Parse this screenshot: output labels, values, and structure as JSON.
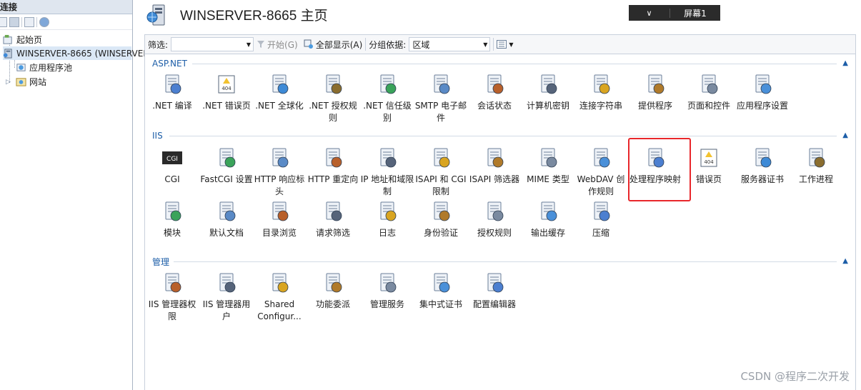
{
  "connections": {
    "header": "连接",
    "tree": [
      {
        "label": "起始页"
      },
      {
        "label": "WINSERVER-8665 (WINSERVER"
      },
      {
        "label": "应用程序池"
      },
      {
        "label": "网站"
      }
    ]
  },
  "header": {
    "title": "WINSERVER-8665 主页"
  },
  "overlay": {
    "chevron": "∨",
    "label": "屏幕1"
  },
  "filterbar": {
    "filter_label": "筛选:",
    "filter_value": "",
    "go_label": "开始(G)",
    "showall_label": "全部显示(A)",
    "groupby_label": "分组依据:",
    "groupby_value": "区域"
  },
  "groups": [
    {
      "title": "ASP.NET",
      "items": [
        {
          "label": ".NET 编译",
          "icon": "dotnet-compile-icon"
        },
        {
          "label": ".NET 错误页",
          "icon": "error-404-icon"
        },
        {
          "label": ".NET 全球化",
          "icon": "globe-icon"
        },
        {
          "label": ".NET 授权规则",
          "icon": "lock-doc-icon"
        },
        {
          "label": ".NET 信任级别",
          "icon": "trust-check-icon"
        },
        {
          "label": "SMTP 电子邮件",
          "icon": "mail-icon"
        },
        {
          "label": "会话状态",
          "icon": "session-icon"
        },
        {
          "label": "计算机密钥",
          "icon": "key-server-icon"
        },
        {
          "label": "连接字符串",
          "icon": "ab-string-icon"
        },
        {
          "label": "提供程序",
          "icon": "provider-icon"
        },
        {
          "label": "页面和控件",
          "icon": "page-controls-icon"
        },
        {
          "label": "应用程序设置",
          "icon": "app-settings-icon"
        }
      ]
    },
    {
      "title": "IIS",
      "items": [
        {
          "label": "CGI",
          "icon": "cgi-icon"
        },
        {
          "label": "FastCGI 设置",
          "icon": "fastcgi-icon"
        },
        {
          "label": "HTTP 响应标头",
          "icon": "http-headers-icon"
        },
        {
          "label": "HTTP 重定向",
          "icon": "redirect-icon"
        },
        {
          "label": "IP 地址和域限制",
          "icon": "ip-restrict-icon"
        },
        {
          "label": "ISAPI 和 CGI 限制",
          "icon": "isapi-cgi-icon"
        },
        {
          "label": "ISAPI 筛选器",
          "icon": "isapi-filter-icon"
        },
        {
          "label": "MIME 类型",
          "icon": "mime-icon"
        },
        {
          "label": "WebDAV 创作规则",
          "icon": "webdav-icon"
        },
        {
          "label": "处理程序映射",
          "icon": "handler-mapping-icon"
        },
        {
          "label": "错误页",
          "icon": "error-page-icon"
        },
        {
          "label": "服务器证书",
          "icon": "certificates-icon"
        },
        {
          "label": "工作进程",
          "icon": "worker-process-icon"
        },
        {
          "label": "模块",
          "icon": "modules-icon"
        },
        {
          "label": "默认文档",
          "icon": "default-doc-icon"
        },
        {
          "label": "目录浏览",
          "icon": "dir-browse-icon"
        },
        {
          "label": "请求筛选",
          "icon": "request-filter-icon"
        },
        {
          "label": "日志",
          "icon": "logging-icon"
        },
        {
          "label": "身份验证",
          "icon": "auth-icon"
        },
        {
          "label": "授权规则",
          "icon": "authz-rules-icon"
        },
        {
          "label": "输出缓存",
          "icon": "output-cache-icon"
        },
        {
          "label": "压缩",
          "icon": "compression-icon"
        }
      ]
    },
    {
      "title": "管理",
      "items": [
        {
          "label": "IIS 管理器权限",
          "icon": "mgr-perms-icon"
        },
        {
          "label": "IIS 管理器用户",
          "icon": "mgr-users-icon"
        },
        {
          "label": "Shared Configur...",
          "icon": "shared-config-icon"
        },
        {
          "label": "功能委派",
          "icon": "feature-delegation-icon"
        },
        {
          "label": "管理服务",
          "icon": "mgmt-service-icon"
        },
        {
          "label": "集中式证书",
          "icon": "central-cert-icon"
        },
        {
          "label": "配置编辑器",
          "icon": "config-editor-icon"
        }
      ]
    }
  ],
  "watermark": "CSDN @程序二次开发",
  "colors": {
    "accent": "#1d5ea8",
    "highlight": "#e8272b",
    "selection": "#dbe8f6"
  }
}
